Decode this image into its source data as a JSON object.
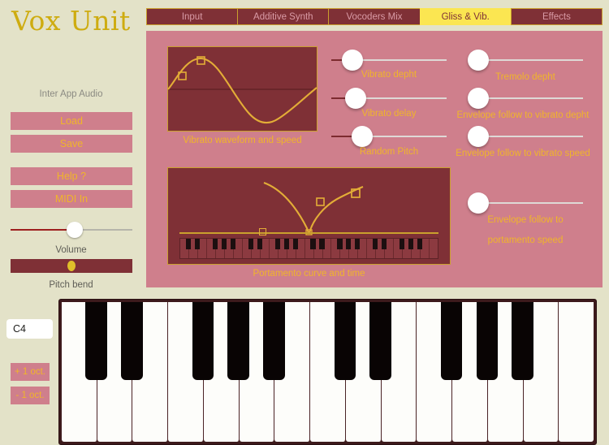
{
  "app": {
    "title": "Vox Unit"
  },
  "sidebar": {
    "iaa_label": "Inter App Audio",
    "load_label": "Load",
    "save_label": "Save",
    "help_label": "Help ?",
    "midi_label": "MIDI In",
    "volume_caption": "Volume",
    "volume_value": 50,
    "pitchbend_caption": "Pitch bend",
    "pitchbend_value": 50,
    "note_value": "C4",
    "oct_up_label": "+ 1 oct.",
    "oct_down_label": "- 1 oct."
  },
  "tabs": [
    {
      "label": "Input",
      "active": false
    },
    {
      "label": "Additive Synth",
      "active": false
    },
    {
      "label": "Vocoders Mix",
      "active": false
    },
    {
      "label": "Gliss & Vib.",
      "active": true
    },
    {
      "label": "Effects",
      "active": false
    }
  ],
  "panel": {
    "vibrato_graph_caption": "Vibrato waveform and speed",
    "portamento_graph_caption": "Portamento curve and time",
    "sliders_left": [
      {
        "label": "Vibrato depht",
        "value": 15
      },
      {
        "label": "Vibrato delay",
        "value": 18
      },
      {
        "label": "Random Pitch",
        "value": 24
      }
    ],
    "sliders_right": [
      {
        "label": "Tremolo depht",
        "value": 0
      },
      {
        "label": "Envelope follow to vibrato depht",
        "value": 0
      },
      {
        "label": "Envelope follow to vibrato speed",
        "value": 0
      },
      {
        "label": "Envelope follow to",
        "label2": "portamento speed",
        "value": 0
      }
    ]
  },
  "colors": {
    "page_bg": "#e3e2c8",
    "panel_bg": "#cf7f8c",
    "graph_bg": "#7f3036",
    "gold": "#f0b52a",
    "gold_line": "#caa02d",
    "title_gold": "#ceac10",
    "tab_active_bg": "#fbe651",
    "tab_bg": "#7f3036",
    "tab_text": "#d99ba6",
    "key_white": "#fdfdfa",
    "key_black": "#090404",
    "volume_track": "#9e1f1f"
  },
  "keyboard": {
    "white_key_count": 15,
    "black_key_pattern": [
      true,
      true,
      false,
      true,
      true,
      true,
      false,
      true,
      true,
      false,
      true,
      true,
      true,
      false,
      false
    ]
  }
}
